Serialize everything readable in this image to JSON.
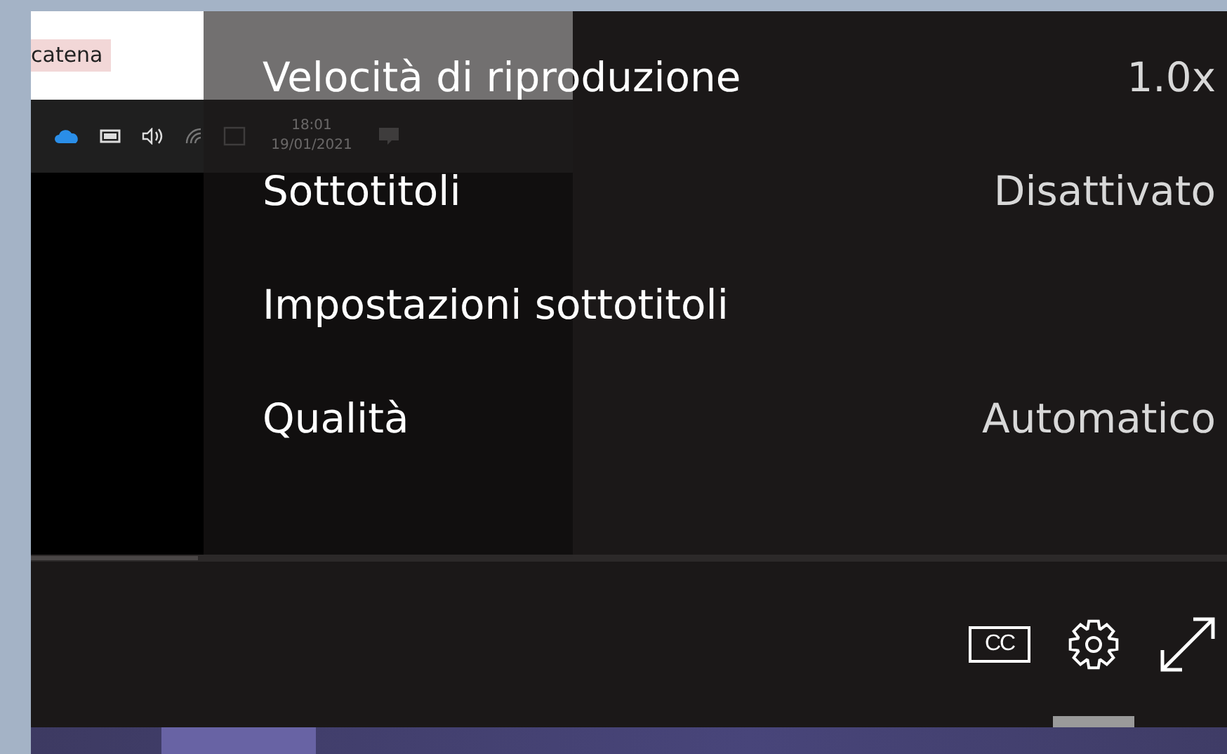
{
  "video_frame": {
    "document_text": "catena",
    "clock_time": "18:01",
    "clock_date": "19/01/2021"
  },
  "settings_menu": {
    "items": [
      {
        "label": "Velocità di riproduzione",
        "value": "1.0x"
      },
      {
        "label": "Sottotitoli",
        "value": "Disattivato"
      },
      {
        "label": "Impostazioni sottotitoli"
      },
      {
        "label": "Qualità",
        "value": "Automatico"
      }
    ]
  },
  "progress": {
    "level": 0.14
  },
  "controls": [
    {
      "kind": "captions",
      "text": "CC",
      "selected": false
    },
    {
      "kind": "settings",
      "selected": true
    },
    {
      "kind": "fullscreen",
      "selected": false
    }
  ]
}
